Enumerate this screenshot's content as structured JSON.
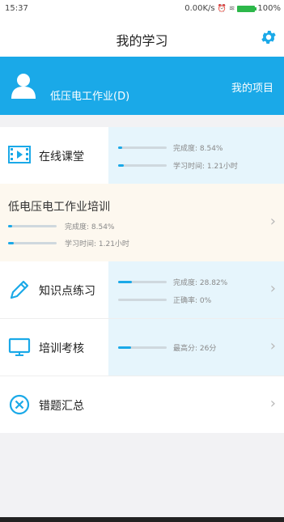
{
  "status": {
    "time": "15:37",
    "speed": "0.00K/s",
    "battery": "100%"
  },
  "header": {
    "title": "我的学习"
  },
  "profile": {
    "name": "低压电工作业(D)",
    "projects_link": "我的项目"
  },
  "online_course": {
    "label": "在线课堂",
    "completion": "完成度: 8.54%",
    "completion_value": 0.0854,
    "study_time": "学习时间: 1.21小时",
    "study_time_value": 0.12
  },
  "training": {
    "title": "低电压电工作业培训",
    "completion": "完成度: 8.54%",
    "completion_value": 0.0854,
    "study_time": "学习时间: 1.21小时",
    "study_time_value": 0.12
  },
  "practice": {
    "label": "知识点练习",
    "completion": "完成度: 28.82%",
    "completion_value": 0.2882,
    "accuracy": "正确率: 0%",
    "accuracy_value": 0
  },
  "exam": {
    "label": "培训考核",
    "top_score": "最高分: 26分",
    "top_score_value": 0.26
  },
  "mistakes": {
    "label": "错题汇总"
  },
  "icons": {
    "settings": "gear-icon",
    "avatar": "user-avatar-icon",
    "video": "video-film-icon",
    "pencil": "pencil-icon",
    "monitor": "monitor-icon",
    "close": "close-circle-icon",
    "chevron": "chevron-right-icon"
  },
  "colors": {
    "accent": "#1aa9e8",
    "training_bg": "#fdf8ef",
    "stats_bg": "#e6f5fc"
  }
}
